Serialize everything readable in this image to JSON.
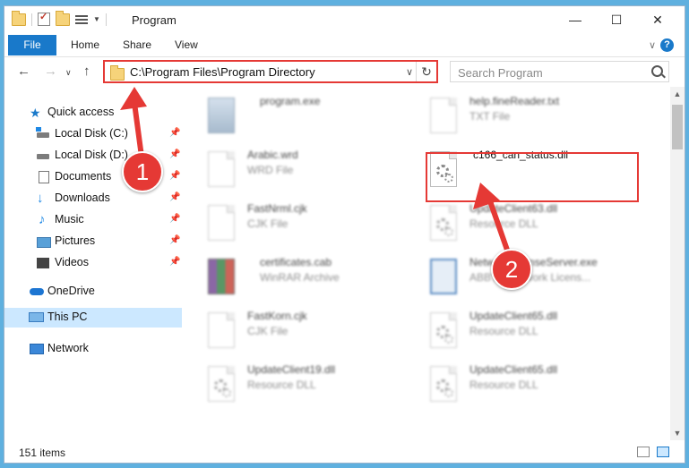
{
  "window": {
    "title": "Program"
  },
  "ribbon": {
    "tabs": [
      "File",
      "Home",
      "Share",
      "View"
    ],
    "help": "?"
  },
  "address": {
    "path": "C:\\Program Files\\Program Directory"
  },
  "search": {
    "placeholder": "Search Program"
  },
  "sidebar": {
    "items": [
      {
        "label": "Quick access",
        "icon": "star-icon"
      },
      {
        "label": "Local Disk (C:)",
        "icon": "drive-icon"
      },
      {
        "label": "Local Disk (D:)",
        "icon": "drive-icon"
      },
      {
        "label": "Documents",
        "icon": "documents-icon"
      },
      {
        "label": "Downloads",
        "icon": "download-icon"
      },
      {
        "label": "Music",
        "icon": "music-icon"
      },
      {
        "label": "Pictures",
        "icon": "pictures-icon"
      },
      {
        "label": "Videos",
        "icon": "videos-icon"
      },
      {
        "label": "OneDrive",
        "icon": "cloud-icon"
      },
      {
        "label": "This PC",
        "icon": "computer-icon"
      },
      {
        "label": "Network",
        "icon": "network-icon"
      }
    ]
  },
  "files": [
    {
      "name": "program.exe",
      "type": ""
    },
    {
      "name": "help.fineReader.txt",
      "type": "TXT File"
    },
    {
      "name": "Arabic.wrd",
      "type": "WRD File"
    },
    {
      "name": "c166_can_status.dll",
      "type": ""
    },
    {
      "name": "FastNrml.cjk",
      "type": "CJK File"
    },
    {
      "name": "UpdateClient63.dll",
      "type": "Resource DLL"
    },
    {
      "name": "certificates.cab",
      "type": "WinRAR Archive"
    },
    {
      "name": "NetworkLicenseServer.exe",
      "type": "ABBYY Network Licens..."
    },
    {
      "name": "FastKorn.cjk",
      "type": "CJK File"
    },
    {
      "name": "UpdateClient65.dll",
      "type": "Resource DLL"
    },
    {
      "name": "UpdateClient19.dll",
      "type": "Resource DLL"
    },
    {
      "name": "UpdateClient65.dll",
      "type": "Resource DLL"
    }
  ],
  "callouts": [
    "1",
    "2"
  ],
  "status": {
    "items": "151 items"
  },
  "colors": {
    "accent": "#1979ca",
    "highlight": "#e53935",
    "selected": "#cce8ff"
  }
}
